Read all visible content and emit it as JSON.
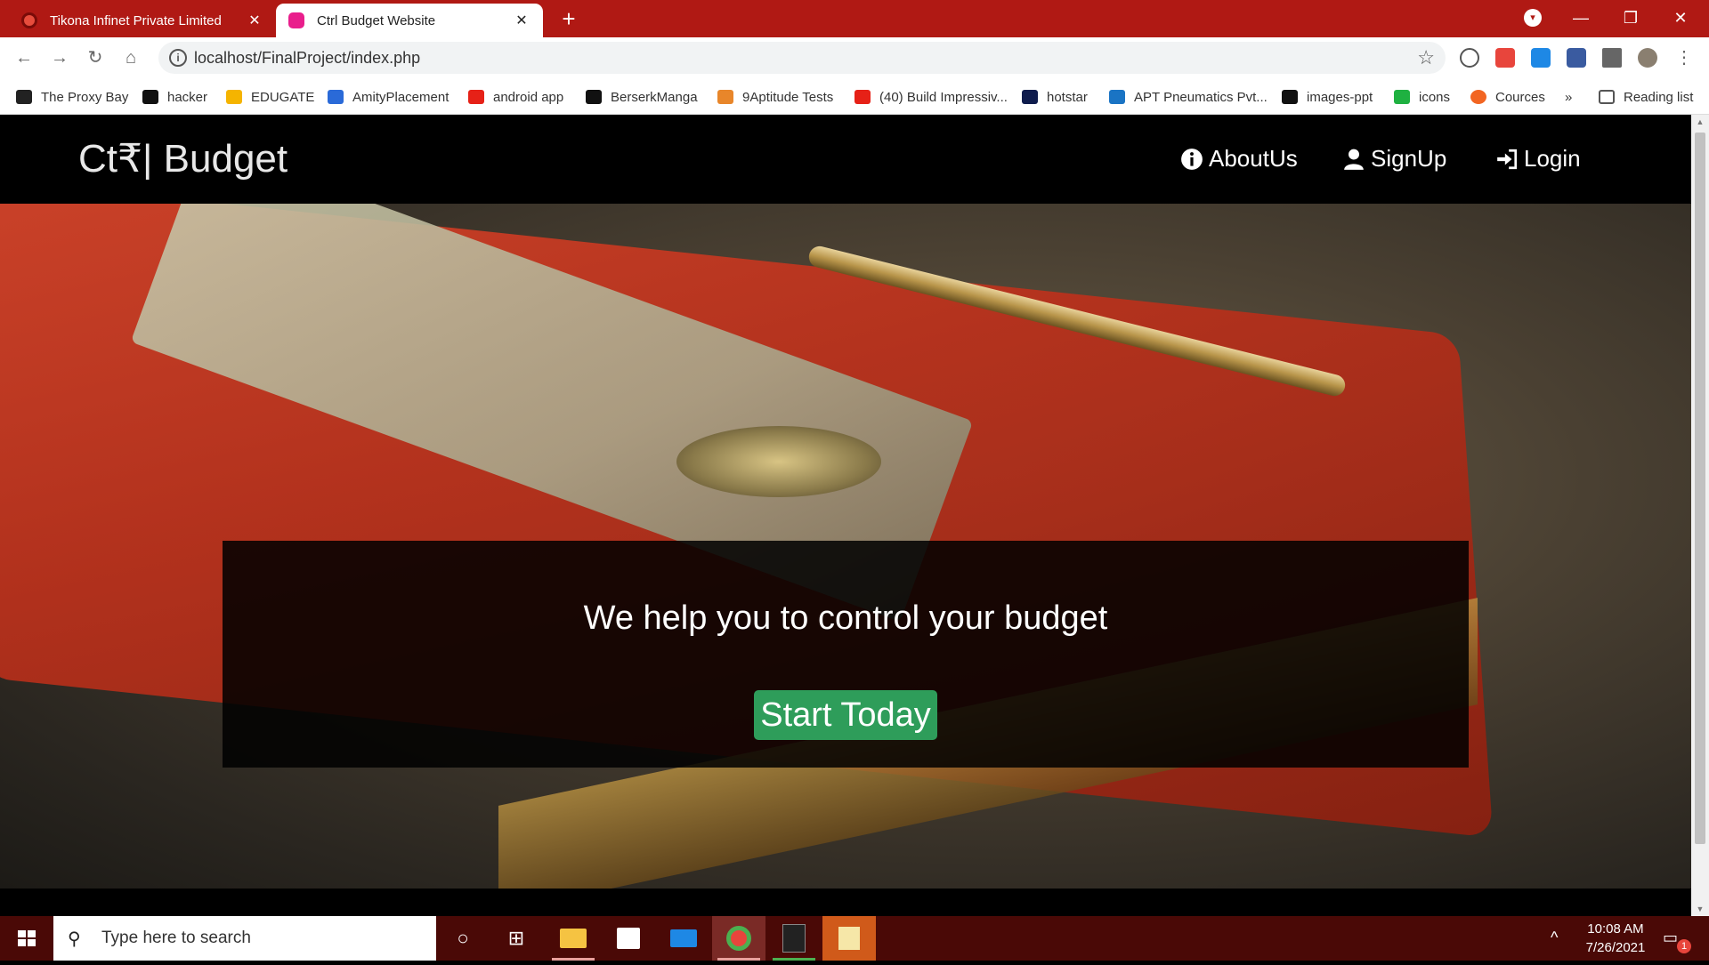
{
  "browser": {
    "tabs": [
      {
        "title": "Tikona Infinet Private Limited",
        "active": false
      },
      {
        "title": "Ctrl Budget Website",
        "active": true
      }
    ],
    "new_tab": "+",
    "close": "✕",
    "url": "localhost/FinalProject/index.php",
    "window_controls": {
      "minimize": "—",
      "restore": "❐",
      "close": "✕"
    },
    "bookmarks": [
      {
        "label": "The Proxy Bay",
        "color": "#222222"
      },
      {
        "label": "hacker",
        "color": "#111111"
      },
      {
        "label": "EDUGATE",
        "color": "#f5b400"
      },
      {
        "label": "AmityPlacement",
        "color": "#2a6ad8"
      },
      {
        "label": "android app",
        "color": "#e62117"
      },
      {
        "label": "BerserkManga",
        "color": "#111111"
      },
      {
        "label": "9Aptitude Tests",
        "color": "#e8862a"
      },
      {
        "label": "(40) Build Impressiv...",
        "color": "#e62117"
      },
      {
        "label": "hotstar",
        "color": "#0f1c4d"
      },
      {
        "label": "APT Pneumatics Pvt...",
        "color": "#1a74c4"
      },
      {
        "label": "images-ppt",
        "color": "#111111"
      },
      {
        "label": "icons",
        "color": "#1fb141"
      },
      {
        "label": "Cources",
        "color": "#f26522"
      }
    ],
    "bookmarks_overflow": "»",
    "reading_list": "Reading list"
  },
  "site": {
    "brand": "Ct₹| Budget",
    "nav": [
      {
        "label": "AboutUs",
        "icon": "info-icon"
      },
      {
        "label": "SignUp",
        "icon": "user-icon"
      },
      {
        "label": "Login",
        "icon": "login-icon"
      }
    ],
    "hero": {
      "headline": "We help you to control your budget",
      "cta": "Start Today",
      "cta_color": "#2e9d5a"
    }
  },
  "taskbar": {
    "search_placeholder": "Type here to search",
    "time": "10:08 AM",
    "date": "7/26/2021",
    "notification_count": "1"
  }
}
